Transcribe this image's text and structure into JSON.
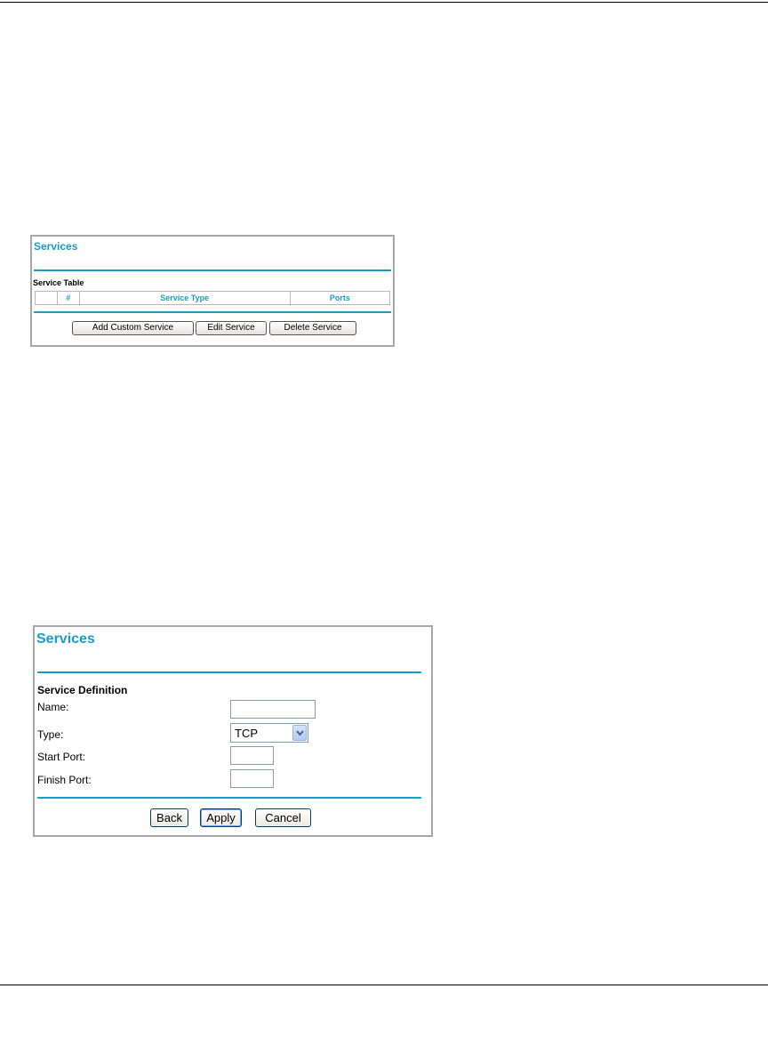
{
  "screen1": {
    "title": "Services",
    "section_label": "Service Table",
    "table": {
      "headers": [
        "",
        "#",
        "Service Type",
        "Ports"
      ],
      "rows": []
    },
    "buttons": {
      "add": "Add Custom Service",
      "edit": "Edit Service",
      "delete": "Delete Service"
    }
  },
  "screen2": {
    "title": "Services",
    "section_label": "Service Definition",
    "fields": {
      "name": {
        "label": "Name:",
        "value": ""
      },
      "type": {
        "label": "Type:",
        "value": "TCP"
      },
      "start_port": {
        "label": "Start Port:",
        "value": ""
      },
      "finish_port": {
        "label": "Finish Port:",
        "value": ""
      }
    },
    "buttons": {
      "back": "Back",
      "apply": "Apply",
      "cancel": "Cancel"
    }
  },
  "colors": {
    "accent": "#1a9cc8",
    "panel_border": "#a8a8a8"
  }
}
